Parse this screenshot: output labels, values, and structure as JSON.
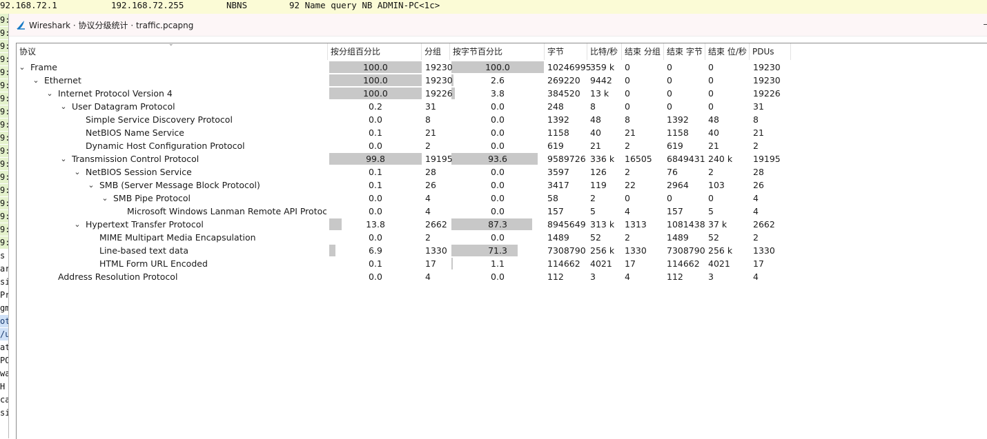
{
  "background": {
    "top_line": {
      "source": "92.168.72.1",
      "destination": "192.168.72.255",
      "protocol": "NBNS",
      "info": "92 Name query NB ADMIN-PC<1c>"
    },
    "left_fragments": [
      "9:",
      "9:",
      "9:",
      "9:",
      "9:",
      "9:",
      "9:",
      "9:",
      "9:",
      "9:",
      "9:",
      "9:",
      "9:",
      "9:",
      "9:",
      "9:",
      "9:",
      "9:",
      "s",
      "ar",
      "si",
      "Pr",
      "gm",
      "ot",
      "/u",
      "at",
      "PO",
      "wa",
      " H",
      "ca",
      "si"
    ]
  },
  "dialog": {
    "title": "Wireshark · 协议分级统计 · traffic.pcapng",
    "columns": [
      "协议",
      "按分组百分比",
      "分组",
      "按字节百分比",
      "字节",
      "比特/秒",
      "结束 分组",
      "结束 字节",
      "结束 位/秒",
      "PDUs"
    ],
    "rows": [
      {
        "indent": 0,
        "twisty": "expanded",
        "name": "Frame",
        "pkt_pct": "100.0",
        "pkt_frac": 1.0,
        "packets": "19230",
        "byte_pct": "100.0",
        "byte_frac": 1.0,
        "bytes": "10246995",
        "bps": "359 k",
        "end_pkts": "0",
        "end_bytes": "0",
        "end_bps": "0",
        "pdus": "19230"
      },
      {
        "indent": 1,
        "twisty": "expanded",
        "name": "Ethernet",
        "pkt_pct": "100.0",
        "pkt_frac": 1.0,
        "packets": "19230",
        "byte_pct": "2.6",
        "byte_frac": 0.026,
        "bytes": "269220",
        "bps": "9442",
        "end_pkts": "0",
        "end_bytes": "0",
        "end_bps": "0",
        "pdus": "19230"
      },
      {
        "indent": 2,
        "twisty": "expanded",
        "name": "Internet Protocol Version 4",
        "pkt_pct": "100.0",
        "pkt_frac": 1.0,
        "packets": "19226",
        "byte_pct": "3.8",
        "byte_frac": 0.038,
        "bytes": "384520",
        "bps": "13 k",
        "end_pkts": "0",
        "end_bytes": "0",
        "end_bps": "0",
        "pdus": "19226"
      },
      {
        "indent": 3,
        "twisty": "expanded",
        "name": "User Datagram Protocol",
        "pkt_pct": "0.2",
        "pkt_frac": 0.002,
        "packets": "31",
        "byte_pct": "0.0",
        "byte_frac": 0.0,
        "bytes": "248",
        "bps": "8",
        "end_pkts": "0",
        "end_bytes": "0",
        "end_bps": "0",
        "pdus": "31"
      },
      {
        "indent": 4,
        "twisty": "none",
        "name": "Simple Service Discovery Protocol",
        "pkt_pct": "0.0",
        "pkt_frac": 0.0,
        "packets": "8",
        "byte_pct": "0.0",
        "byte_frac": 0.0,
        "bytes": "1392",
        "bps": "48",
        "end_pkts": "8",
        "end_bytes": "1392",
        "end_bps": "48",
        "pdus": "8"
      },
      {
        "indent": 4,
        "twisty": "none",
        "name": "NetBIOS Name Service",
        "pkt_pct": "0.1",
        "pkt_frac": 0.001,
        "packets": "21",
        "byte_pct": "0.0",
        "byte_frac": 0.0,
        "bytes": "1158",
        "bps": "40",
        "end_pkts": "21",
        "end_bytes": "1158",
        "end_bps": "40",
        "pdus": "21"
      },
      {
        "indent": 4,
        "twisty": "none",
        "name": "Dynamic Host Configuration Protocol",
        "pkt_pct": "0.0",
        "pkt_frac": 0.0,
        "packets": "2",
        "byte_pct": "0.0",
        "byte_frac": 0.0,
        "bytes": "619",
        "bps": "21",
        "end_pkts": "2",
        "end_bytes": "619",
        "end_bps": "21",
        "pdus": "2"
      },
      {
        "indent": 3,
        "twisty": "expanded",
        "name": "Transmission Control Protocol",
        "pkt_pct": "99.8",
        "pkt_frac": 0.998,
        "packets": "19195",
        "byte_pct": "93.6",
        "byte_frac": 0.936,
        "bytes": "9589726",
        "bps": "336 k",
        "end_pkts": "16505",
        "end_bytes": "6849431",
        "end_bps": "240 k",
        "pdus": "19195"
      },
      {
        "indent": 4,
        "twisty": "expanded",
        "name": "NetBIOS Session Service",
        "pkt_pct": "0.1",
        "pkt_frac": 0.001,
        "packets": "28",
        "byte_pct": "0.0",
        "byte_frac": 0.0,
        "bytes": "3597",
        "bps": "126",
        "end_pkts": "2",
        "end_bytes": "76",
        "end_bps": "2",
        "pdus": "28"
      },
      {
        "indent": 5,
        "twisty": "expanded",
        "name": "SMB (Server Message Block Protocol)",
        "pkt_pct": "0.1",
        "pkt_frac": 0.001,
        "packets": "26",
        "byte_pct": "0.0",
        "byte_frac": 0.0,
        "bytes": "3417",
        "bps": "119",
        "end_pkts": "22",
        "end_bytes": "2964",
        "end_bps": "103",
        "pdus": "26"
      },
      {
        "indent": 6,
        "twisty": "expanded",
        "name": "SMB Pipe Protocol",
        "pkt_pct": "0.0",
        "pkt_frac": 0.0,
        "packets": "4",
        "byte_pct": "0.0",
        "byte_frac": 0.0,
        "bytes": "58",
        "bps": "2",
        "end_pkts": "0",
        "end_bytes": "0",
        "end_bps": "0",
        "pdus": "4"
      },
      {
        "indent": 7,
        "twisty": "none",
        "name": "Microsoft Windows Lanman Remote API Protocol",
        "pkt_pct": "0.0",
        "pkt_frac": 0.0,
        "packets": "4",
        "byte_pct": "0.0",
        "byte_frac": 0.0,
        "bytes": "157",
        "bps": "5",
        "end_pkts": "4",
        "end_bytes": "157",
        "end_bps": "5",
        "pdus": "4"
      },
      {
        "indent": 4,
        "twisty": "expanded",
        "name": "Hypertext Transfer Protocol",
        "pkt_pct": "13.8",
        "pkt_frac": 0.138,
        "packets": "2662",
        "byte_pct": "87.3",
        "byte_frac": 0.873,
        "bytes": "8945649",
        "bps": "313 k",
        "end_pkts": "1313",
        "end_bytes": "1081438",
        "end_bps": "37 k",
        "pdus": "2662"
      },
      {
        "indent": 5,
        "twisty": "none",
        "name": "MIME Multipart Media Encapsulation",
        "pkt_pct": "0.0",
        "pkt_frac": 0.0,
        "packets": "2",
        "byte_pct": "0.0",
        "byte_frac": 0.0,
        "bytes": "1489",
        "bps": "52",
        "end_pkts": "2",
        "end_bytes": "1489",
        "end_bps": "52",
        "pdus": "2"
      },
      {
        "indent": 5,
        "twisty": "none",
        "name": "Line-based text data",
        "pkt_pct": "6.9",
        "pkt_frac": 0.069,
        "packets": "1330",
        "byte_pct": "71.3",
        "byte_frac": 0.713,
        "bytes": "7308790",
        "bps": "256 k",
        "end_pkts": "1330",
        "end_bytes": "7308790",
        "end_bps": "256 k",
        "pdus": "1330"
      },
      {
        "indent": 5,
        "twisty": "none",
        "name": "HTML Form URL Encoded",
        "pkt_pct": "0.1",
        "pkt_frac": 0.001,
        "packets": "17",
        "byte_pct": "1.1",
        "byte_frac": 0.011,
        "bytes": "114662",
        "bps": "4021",
        "end_pkts": "17",
        "end_bytes": "114662",
        "end_bps": "4021",
        "pdus": "17"
      },
      {
        "indent": 2,
        "twisty": "none",
        "name": "Address Resolution Protocol",
        "pkt_pct": "0.0",
        "pkt_frac": 0.0,
        "packets": "4",
        "byte_pct": "0.0",
        "byte_frac": 0.0,
        "bytes": "112",
        "bps": "3",
        "end_pkts": "4",
        "end_bytes": "112",
        "end_bps": "3",
        "pdus": "4"
      }
    ]
  },
  "colors": {
    "bar": "#c8c8c8",
    "background_row": "#fbfbd6",
    "title_bg": "#fdf6f7"
  }
}
